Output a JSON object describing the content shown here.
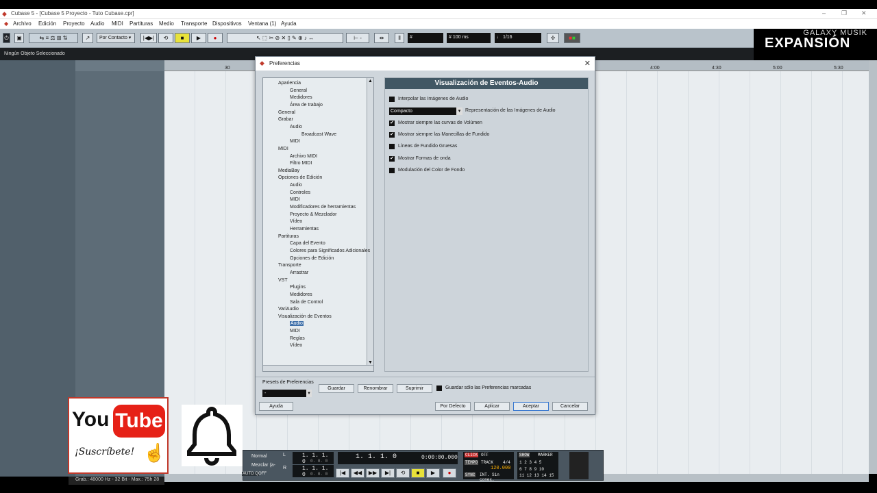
{
  "window": {
    "title": "Cubase 5 - [Cubase 5 Proyecto - Tuto Cubase.cpr]",
    "controls": [
      "–",
      "❐",
      "✕"
    ]
  },
  "menu": [
    "Archivo",
    "Edición",
    "Proyecto",
    "Audio",
    "MIDI",
    "Partituras",
    "Medio",
    "Transporte",
    "Dispositivos",
    "Ventana (1)",
    "Ayuda"
  ],
  "toolbar": {
    "snap_mode": "Por Contacto",
    "quantize_time": "100 ms",
    "grid": "1/16",
    "minus": "-"
  },
  "info_line": "Ningún Objeto Seleccionado",
  "logo": {
    "top": "GALAXY MUSIK",
    "main": "EXPANSIÓN"
  },
  "ruler_labels": [
    "30",
    "4:00",
    "4:30",
    "5:00",
    "5:30"
  ],
  "status_bar": "Grab.: 48000 Hz - 32 Bit - Max.: 75h 28",
  "dialog": {
    "title": "Preferencias",
    "tree": [
      {
        "label": "Apariencia",
        "level": 0
      },
      {
        "label": "General",
        "level": 1
      },
      {
        "label": "Medidores",
        "level": 1
      },
      {
        "label": "Área de trabajo",
        "level": 1
      },
      {
        "label": "General",
        "level": 0
      },
      {
        "label": "Grabar",
        "level": 0
      },
      {
        "label": "Audio",
        "level": 1
      },
      {
        "label": "Broadcast Wave",
        "level": 2
      },
      {
        "label": "MIDI",
        "level": 1
      },
      {
        "label": "MIDI",
        "level": 0
      },
      {
        "label": "Archivo MIDI",
        "level": 1
      },
      {
        "label": "Filtro MIDI",
        "level": 1
      },
      {
        "label": "MediaBay",
        "level": 0
      },
      {
        "label": "Opciones de Edición",
        "level": 0
      },
      {
        "label": "Audio",
        "level": 1
      },
      {
        "label": "Controles",
        "level": 1
      },
      {
        "label": "MIDI",
        "level": 1
      },
      {
        "label": "Modificadores de herramientas",
        "level": 1
      },
      {
        "label": "Proyecto & Mezclador",
        "level": 1
      },
      {
        "label": "Vídeo",
        "level": 1
      },
      {
        "label": "Herramientas",
        "level": 1
      },
      {
        "label": "Partituras",
        "level": 0
      },
      {
        "label": "Capa del Evento",
        "level": 1
      },
      {
        "label": "Colores para Significados Adicionales",
        "level": 1
      },
      {
        "label": "Opciones de Edición",
        "level": 1
      },
      {
        "label": "Transporte",
        "level": 0
      },
      {
        "label": "Arrastrar",
        "level": 1
      },
      {
        "label": "VST",
        "level": 0
      },
      {
        "label": "Plugins",
        "level": 1
      },
      {
        "label": "Medidores",
        "level": 1
      },
      {
        "label": "Sala de Control",
        "level": 1
      },
      {
        "label": "VariAudio",
        "level": 0
      },
      {
        "label": "Visualización de Eventos",
        "level": 0
      },
      {
        "label": "Audio",
        "level": 1,
        "selected": true
      },
      {
        "label": "MIDI",
        "level": 1
      },
      {
        "label": "Reglas",
        "level": 1
      },
      {
        "label": "Vídeo",
        "level": 1
      }
    ],
    "panel": {
      "heading": "Visualización de Eventos-Audio",
      "options": [
        {
          "label": "Interpolar las Imágenes de Audio",
          "checked": false
        },
        {
          "label": "Mostrar siempre las curvas de Volúmen",
          "checked": true
        },
        {
          "label": "Mostrar siempre las Manecillas de Fundido",
          "checked": true
        },
        {
          "label": "Líneas de Fundido Gruesas",
          "checked": false
        },
        {
          "label": "Mostrar Formas de onda",
          "checked": true
        },
        {
          "label": "Modulación del Color de Fondo",
          "checked": false
        }
      ],
      "waveform_select": {
        "value": "Compacto",
        "label": "Representación de las Imágenes de Audio"
      }
    },
    "presets_label": "Presets de Preferencias",
    "preset_value": "-",
    "preset_buttons": [
      "Guardar",
      "Renombrar",
      "Suprimir"
    ],
    "save_marked_only": {
      "label": "Guardar sólo las Preferencias marcadas",
      "checked": false
    },
    "buttons": {
      "help": "Ayuda",
      "default": "Por Defecto",
      "apply": "Aplicar",
      "accept": "Aceptar",
      "cancel": "Cancelar"
    }
  },
  "transport": {
    "mode": "Normal",
    "mix": "Mezclar (a-",
    "autoq": "AUTO Q",
    "off": "OFF",
    "left_locator": "1. 1. 1.   0",
    "left_locator_sub": "0. 0. 0",
    "right_locator": "1. 1. 1.   0",
    "right_locator_sub": "0. 0. 0",
    "position": "1. 1. 1.   0",
    "time": "0:00:00.000",
    "click": "CLICK",
    "click_val": "OFF",
    "tempo": "TEMPO",
    "track": "TRACK",
    "signature": "4/4",
    "bpm": "120.000",
    "sync": "SYNC",
    "sync_val": "INT. Sin conex.",
    "show": "SHOW",
    "marker": "MARKER",
    "marker_rows": [
      "1  2  3  4  5",
      "6  7  8  9  10",
      "11 12 13 14 15"
    ],
    "lr": [
      "L",
      "R"
    ]
  },
  "youtube": {
    "you": "You",
    "tube": "Tube",
    "subscribe": "¡Suscríbete!"
  }
}
